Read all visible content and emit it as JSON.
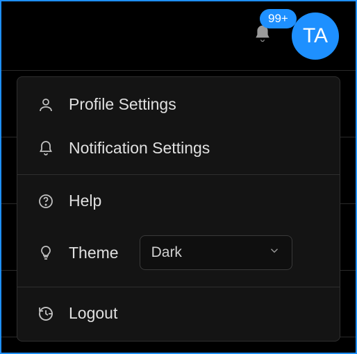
{
  "header": {
    "notification_count": "99+",
    "avatar_initials": "TA"
  },
  "menu": {
    "profile_label": "Profile Settings",
    "notifications_label": "Notification Settings",
    "help_label": "Help",
    "theme_label": "Theme",
    "theme_value": "Dark",
    "logout_label": "Logout"
  },
  "colors": {
    "accent": "#1e90ff"
  }
}
